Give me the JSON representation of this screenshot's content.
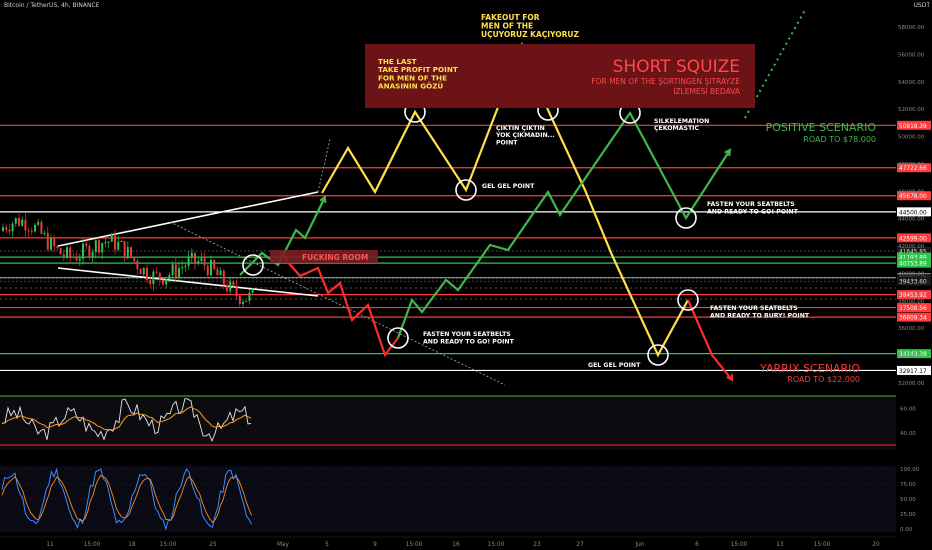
{
  "header": {
    "symbol_line": "Bitcoin / TetherUS, 4h, BINANCE",
    "currency": "USDT"
  },
  "chart_data": {
    "type": "line",
    "symbol": "Bitcoin / TetherUS",
    "timeframe": "4h",
    "exchange": "BINANCE",
    "y_axis_ticks": [
      58000,
      56000,
      54000,
      52000,
      50000,
      48000,
      46000,
      44000,
      42000,
      40000,
      38000,
      36000,
      34000,
      32000
    ],
    "x_axis_ticks": [
      "11",
      "15:00",
      "18",
      "15:00",
      "25",
      "May",
      "5",
      "9",
      "15:00",
      "16",
      "15:00",
      "23",
      "27",
      "Jun",
      "6",
      "15:00",
      "13",
      "15:00",
      "20"
    ],
    "price_levels": [
      {
        "price": 50819.39,
        "label": "50819.39",
        "color": "#ff3b3b"
      },
      {
        "price": 47722.66,
        "label": "47722.66",
        "color": "#ff3b3b"
      },
      {
        "price": 45678.0,
        "label": "45678.00",
        "color": "#ff3b3b"
      },
      {
        "price": 44500.0,
        "label": "44500.00",
        "color": "#ffffff"
      },
      {
        "price": 42599.0,
        "label": "42599.00",
        "color": "#ff3b3b"
      },
      {
        "price": 41645.85,
        "label": "41645.85",
        "color": "#444444"
      },
      {
        "price": 41193.89,
        "label": "41193.89",
        "color": "#2ec44a"
      },
      {
        "price": 40753.89,
        "label": "40753.89",
        "color": "#2ec44a"
      },
      {
        "price": 39700.0,
        "label": "39700.00",
        "color": "#2ec44a"
      },
      {
        "price": 39624.47,
        "label": "39624.47",
        "color": "#444444"
      },
      {
        "price": 39433.6,
        "label": "39433.60",
        "color": "#444444"
      },
      {
        "price": 38453.92,
        "label": "38453.92",
        "color": "#ff3b3b"
      },
      {
        "price": 37508.56,
        "label": "37508.56",
        "color": "#ff3b3b"
      },
      {
        "price": 36809.34,
        "label": "36809.34",
        "color": "#ff3b3b"
      },
      {
        "price": 34143.38,
        "label": "34143.38",
        "color": "#2ec44a"
      },
      {
        "price": 32917.17,
        "label": "32917.17",
        "color": "#ffffff"
      }
    ],
    "rsi_ticks": [
      60,
      40
    ],
    "stoch_ticks": [
      100,
      75,
      50,
      25,
      0
    ]
  },
  "annotations": {
    "fakeout": [
      "FAKEOUT FOR",
      "MEN OF THE",
      "UÇUYORUZ KAÇIYORUZ"
    ],
    "last_tp": [
      "THE LAST",
      "TAKE PROFIT POINT",
      "FOR MEN OF THE",
      "ANASININ GÖZÜ"
    ],
    "short_squeeze_title": "SHORT SQUIZE",
    "short_squeeze_sub1": "FOR MEN OF THE ŞORTINGEN ŞITRAYZE",
    "short_squeeze_sub2": "İZLEMESİ BEDAVA",
    "ciktin": [
      "ÇIKTIN ÇIKTIN",
      "YOK ÇIKMADIN...",
      "POINT"
    ],
    "silkele": [
      "SILKELEMATION",
      "ÇEKOMASTIC"
    ],
    "positive_title": "POSITIVE SCENARIO",
    "positive_sub": "ROAD TO $78.000",
    "gel_gel_top": "GEL GEL POINT",
    "seatbelt_go_right": [
      "FASTEN YOUR SEATBELTS",
      "AND READY TO GO! POINT"
    ],
    "fucking_room": "FUCKING ROOM",
    "seatbelt_bury": [
      "FASTEN YOUR SEATBELTS",
      "AND READY TO BURY! POINT"
    ],
    "seatbelt_go_left": [
      "FASTEN YOUR SEATBELTS",
      "AND READY TO GO! POINT"
    ],
    "gel_gel_bottom": "GEL GEL POINT",
    "yarrix_title": "YARRIX SCENARIO",
    "yarrix_sub": "ROAD TO $22.000"
  },
  "colors": {
    "yellow": "#ffe14a",
    "green": "#3fb84a",
    "red": "#ff2b2b",
    "white": "#ffffff",
    "box": "#6b1316",
    "fucking_room_box": "#7a1f22"
  }
}
